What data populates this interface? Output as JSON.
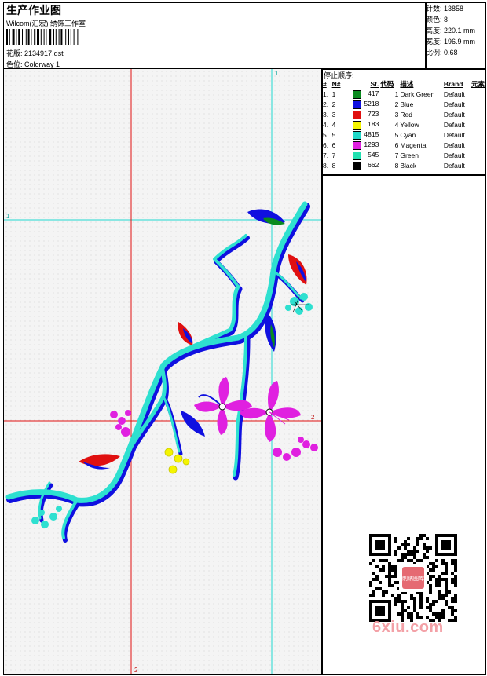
{
  "header": {
    "title": "生产作业图",
    "subtitle": "Wilcom(汇宏) 绣饰工作室",
    "design_label": "花版:",
    "design_value": "2134917.dst",
    "colorway_label": "色位:",
    "colorway_value": "Colorway 1"
  },
  "stats": [
    {
      "label": "针数:",
      "value": "13858"
    },
    {
      "label": "颜色:",
      "value": "8"
    },
    {
      "label": "高度:",
      "value": "220.1 mm"
    },
    {
      "label": "宽度:",
      "value": "196.9 mm"
    },
    {
      "label": "比例:",
      "value": "0.68"
    }
  ],
  "stop_sequence": {
    "title": "停止顺序:",
    "columns": [
      "#",
      "N#",
      "St.",
      "代码",
      "描述",
      "Brand",
      "元素"
    ],
    "rows": [
      {
        "idx": "1.",
        "n": "1",
        "color": "#0a8a1e",
        "st": "417",
        "code": "1",
        "desc": "Dark Green",
        "brand": "Default"
      },
      {
        "idx": "2.",
        "n": "2",
        "color": "#1010e0",
        "st": "5218",
        "code": "2",
        "desc": "Blue",
        "brand": "Default"
      },
      {
        "idx": "3.",
        "n": "3",
        "color": "#e01010",
        "st": "723",
        "code": "3",
        "desc": "Red",
        "brand": "Default"
      },
      {
        "idx": "4.",
        "n": "4",
        "color": "#f4f400",
        "st": "183",
        "code": "4",
        "desc": "Yellow",
        "brand": "Default"
      },
      {
        "idx": "5.",
        "n": "5",
        "color": "#20d8c8",
        "st": "4815",
        "code": "5",
        "desc": "Cyan",
        "brand": "Default"
      },
      {
        "idx": "6.",
        "n": "6",
        "color": "#e020e0",
        "st": "1293",
        "code": "6",
        "desc": "Magenta",
        "brand": "Default"
      },
      {
        "idx": "7.",
        "n": "7",
        "color": "#20e0b0",
        "st": "545",
        "code": "7",
        "desc": "Green",
        "brand": "Default"
      },
      {
        "idx": "8.",
        "n": "8",
        "color": "#000000",
        "st": "662",
        "code": "8",
        "desc": "Black",
        "brand": "Default"
      }
    ]
  },
  "guides": {
    "v1": "1",
    "h1": "1",
    "h2": "2",
    "v2": "2"
  },
  "watermark": "6xiu.com",
  "qr_badge": "刺绣图库"
}
